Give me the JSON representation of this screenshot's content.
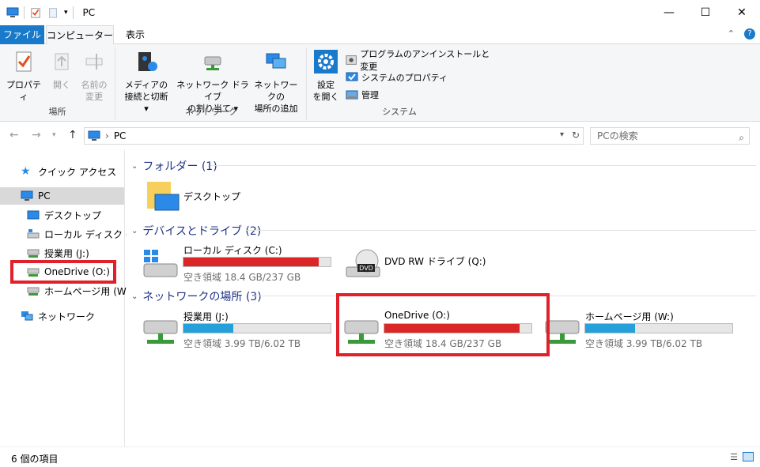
{
  "window": {
    "title": "PC"
  },
  "tabs": {
    "file": "ファイル",
    "computer": "コンピューター",
    "view": "表示"
  },
  "ribbon": {
    "groups": {
      "location": "場所",
      "network": "ネットワーク",
      "system": "システム"
    },
    "properties": "プロパティ",
    "open": "開く",
    "rename_line1": "名前の",
    "rename_line2": "変更",
    "media_line1": "メディアの",
    "media_line2": "接続と切断 ▾",
    "mapdrive_line1": "ネットワーク ドライブ",
    "mapdrive_line2": "の割り当て ▾",
    "addnet_line1": "ネットワークの",
    "addnet_line2": "場所の追加",
    "settings_line1": "設定",
    "settings_line2": "を開く",
    "uninstall": "プログラムのアンインストールと変更",
    "sysprops": "システムのプロパティ",
    "manage": "管理"
  },
  "address": {
    "path": "PC",
    "search_placeholder": "PCの検索"
  },
  "nav": {
    "quick_access": "クイック アクセス",
    "pc": "PC",
    "desktop": "デスクトップ",
    "local_disk": "ローカル ディスク (C:)",
    "jugyo": "授業用 (J:)",
    "onedrive": "OneDrive (O:)",
    "homepage": "ホームページ用 (W:)",
    "network": "ネットワーク"
  },
  "content": {
    "folders_header": "フォルダー (1)",
    "desktop_folder": "デスクトップ",
    "devices_header": "デバイスとドライブ (2)",
    "network_header": "ネットワークの場所 (3)",
    "drives": {
      "c": {
        "name": "ローカル ディスク (C:)",
        "free": "空き領域 18.4 GB/237 GB",
        "used_fraction": 0.92,
        "color": "#da2626"
      },
      "dvd": {
        "name": "DVD RW ドライブ (Q:)"
      },
      "j": {
        "name": "授業用 (J:)",
        "free": "空き領域 3.99 TB/6.02 TB",
        "used_fraction": 0.34,
        "color": "#26a0da"
      },
      "o": {
        "name": "OneDrive (O:)",
        "free": "空き領域 18.4 GB/237 GB",
        "used_fraction": 0.92,
        "color": "#da2626"
      },
      "w": {
        "name": "ホームページ用 (W:)",
        "free": "空き領域 3.99 TB/6.02 TB",
        "used_fraction": 0.34,
        "color": "#26a0da"
      }
    }
  },
  "status": {
    "count": "6 個の項目"
  }
}
